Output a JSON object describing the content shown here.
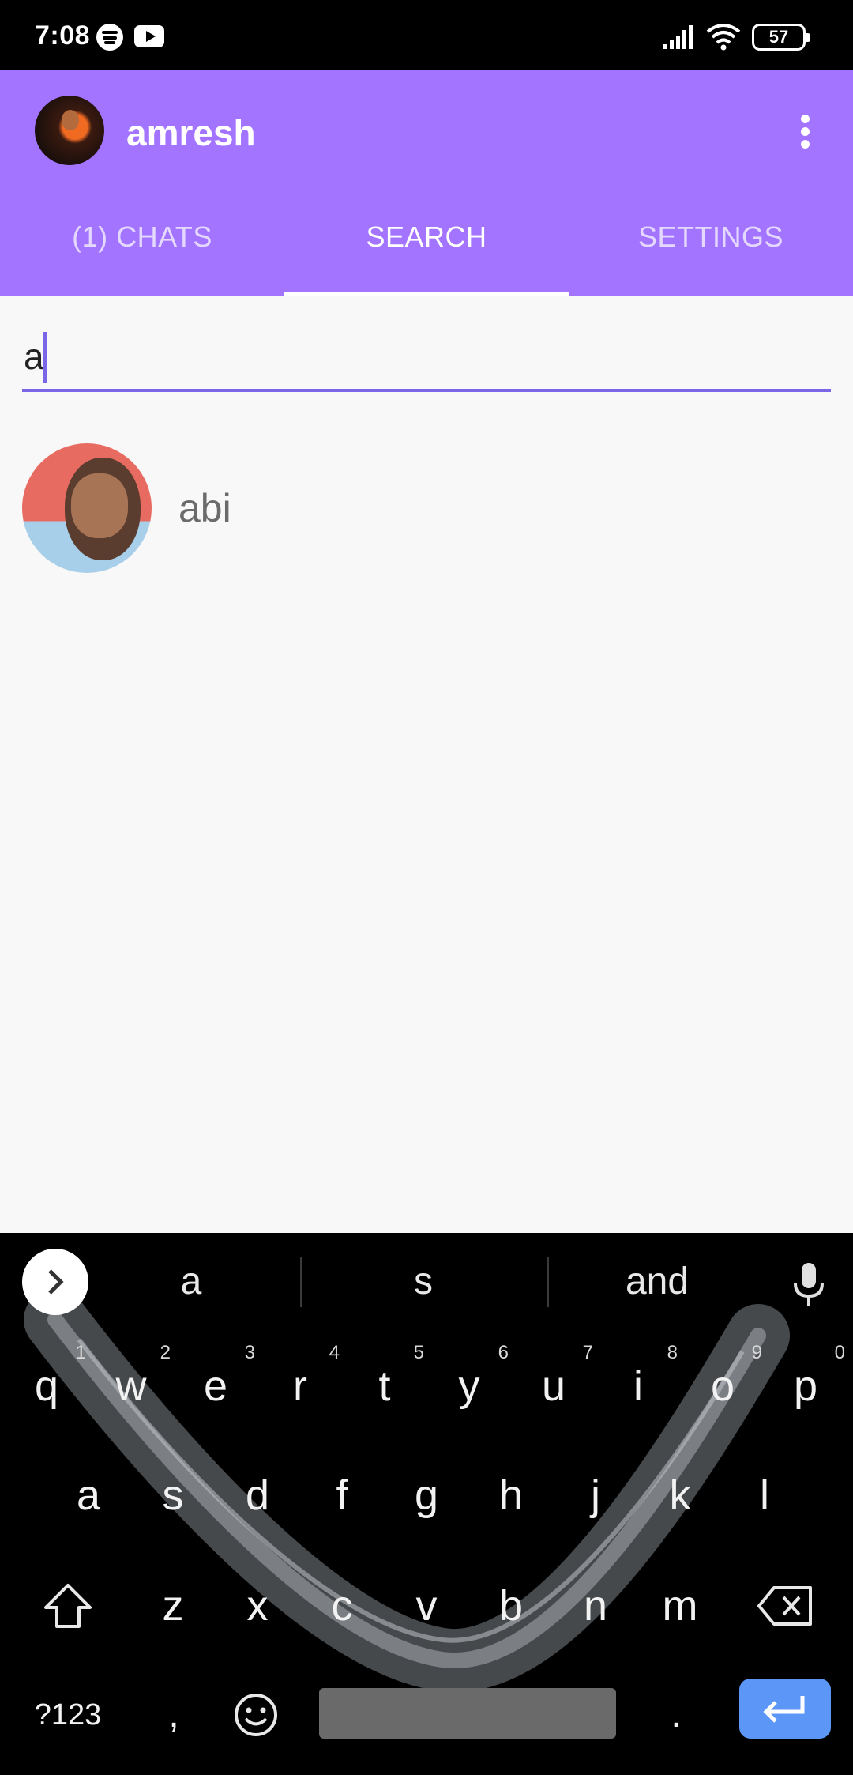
{
  "status_bar": {
    "time": "7:08",
    "battery": "57",
    "icons": [
      "spotify-icon",
      "youtube-icon",
      "signal-icon",
      "wifi-icon",
      "battery-icon"
    ]
  },
  "app_bar": {
    "title": "amresh",
    "tabs": [
      {
        "label": "(1) CHATS",
        "active": false
      },
      {
        "label": "SEARCH",
        "active": true
      },
      {
        "label": "SETTINGS",
        "active": false
      }
    ],
    "accent_color": "#a374ff"
  },
  "search": {
    "value": "a",
    "underline_color": "#7a67e8"
  },
  "results": [
    {
      "name": "abi"
    }
  ],
  "keyboard": {
    "suggestions": [
      "a",
      "s",
      "and"
    ],
    "row1": [
      {
        "k": "q",
        "n": "1"
      },
      {
        "k": "w",
        "n": "2"
      },
      {
        "k": "e",
        "n": "3"
      },
      {
        "k": "r",
        "n": "4"
      },
      {
        "k": "t",
        "n": "5"
      },
      {
        "k": "y",
        "n": "6"
      },
      {
        "k": "u",
        "n": "7"
      },
      {
        "k": "i",
        "n": "8"
      },
      {
        "k": "o",
        "n": "9"
      },
      {
        "k": "p",
        "n": "0"
      }
    ],
    "row2": [
      "a",
      "s",
      "d",
      "f",
      "g",
      "h",
      "j",
      "k",
      "l"
    ],
    "row3": [
      "z",
      "x",
      "c",
      "v",
      "b",
      "n",
      "m"
    ],
    "symbols_label": "?123",
    "comma_label": ",",
    "period_label": ".",
    "enter_color": "#5c97f7"
  }
}
